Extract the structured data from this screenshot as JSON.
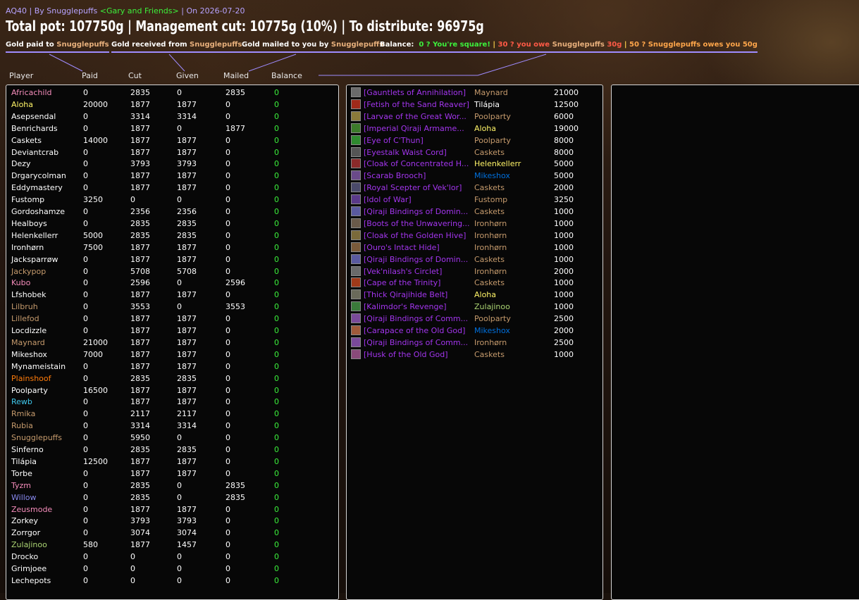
{
  "header": {
    "raid": "AQ40",
    "by_prefix": "By",
    "author": "Snugglepuffs",
    "guild": "<Gary and Friends>",
    "date_prefix": "On",
    "date": "2026-07-20",
    "headline": "Total pot: 107750g | Management cut: 10775g (10%) | To distribute: 96975g"
  },
  "legend": {
    "paid_label": "Gold paid to",
    "paid_name": "Snugglepuffs",
    "received_label": "Gold received from",
    "received_name": "Snugglepuffs",
    "mailed_label": "Gold mailed to you by",
    "mailed_name": "Snugglepuffs",
    "balance_label": "Balance:",
    "square_text": "0 ? You're square!",
    "sep1": "|",
    "owe_prefix": "30 ? you owe",
    "owe_name": "Snugglepuffs",
    "owe_amount": "30g",
    "sep2": "|",
    "owed_text": "50 ? Snugglepuffs owes you 50g",
    "colors": {
      "underline": "#9f8cff",
      "name": "#e8b07c",
      "square": "#3cf03c",
      "owe": "#ff5a46",
      "owed": "#ffa64a"
    }
  },
  "columns": [
    "Player",
    "Paid",
    "Cut",
    "Given",
    "Mailed",
    "Balance"
  ],
  "players": [
    {
      "name": "Africachild",
      "paid": "0",
      "cut": "2835",
      "given": "0",
      "mailed": "2835",
      "balance": "0",
      "color": "#f48cba"
    },
    {
      "name": "Aloha",
      "paid": "20000",
      "cut": "1877",
      "given": "1877",
      "mailed": "0",
      "balance": "0",
      "color": "#fff468"
    },
    {
      "name": "Asepsendal",
      "paid": "0",
      "cut": "3314",
      "given": "3314",
      "mailed": "0",
      "balance": "0",
      "color": "#ffffff"
    },
    {
      "name": "Benrichards",
      "paid": "0",
      "cut": "1877",
      "given": "0",
      "mailed": "1877",
      "balance": "0",
      "color": "#ffffff"
    },
    {
      "name": "Caskets",
      "paid": "14000",
      "cut": "1877",
      "given": "1877",
      "mailed": "0",
      "balance": "0",
      "color": "#ffffff"
    },
    {
      "name": "Deviantcrab",
      "paid": "0",
      "cut": "1877",
      "given": "1877",
      "mailed": "0",
      "balance": "0",
      "color": "#ffffff"
    },
    {
      "name": "Dezy",
      "paid": "0",
      "cut": "3793",
      "given": "3793",
      "mailed": "0",
      "balance": "0",
      "color": "#ffffff"
    },
    {
      "name": "Drgarycolman",
      "paid": "0",
      "cut": "1877",
      "given": "1877",
      "mailed": "0",
      "balance": "0",
      "color": "#ffffff"
    },
    {
      "name": "Eddymastery",
      "paid": "0",
      "cut": "1877",
      "given": "1877",
      "mailed": "0",
      "balance": "0",
      "color": "#ffffff"
    },
    {
      "name": "Fustomp",
      "paid": "3250",
      "cut": "0",
      "given": "0",
      "mailed": "0",
      "balance": "0",
      "color": "#ffffff"
    },
    {
      "name": "Gordoshamze",
      "paid": "0",
      "cut": "2356",
      "given": "2356",
      "mailed": "0",
      "balance": "0",
      "color": "#ffffff"
    },
    {
      "name": "Healboys",
      "paid": "0",
      "cut": "2835",
      "given": "2835",
      "mailed": "0",
      "balance": "0",
      "color": "#ffffff"
    },
    {
      "name": "Helenkellerr",
      "paid": "5000",
      "cut": "2835",
      "given": "2835",
      "mailed": "0",
      "balance": "0",
      "color": "#ffffff"
    },
    {
      "name": "Ironhørn",
      "paid": "7500",
      "cut": "1877",
      "given": "1877",
      "mailed": "0",
      "balance": "0",
      "color": "#ffffff"
    },
    {
      "name": "Jacksparrøw",
      "paid": "0",
      "cut": "1877",
      "given": "1877",
      "mailed": "0",
      "balance": "0",
      "color": "#ffffff"
    },
    {
      "name": "Jackypop",
      "paid": "0",
      "cut": "5708",
      "given": "5708",
      "mailed": "0",
      "balance": "0",
      "color": "#c69b6d"
    },
    {
      "name": "Kubo",
      "paid": "0",
      "cut": "2596",
      "given": "0",
      "mailed": "2596",
      "balance": "0",
      "color": "#f48cba"
    },
    {
      "name": "Lfshobek",
      "paid": "0",
      "cut": "1877",
      "given": "1877",
      "mailed": "0",
      "balance": "0",
      "color": "#ffffff"
    },
    {
      "name": "Lilbruh",
      "paid": "0",
      "cut": "3553",
      "given": "0",
      "mailed": "3553",
      "balance": "0",
      "color": "#c69b6d"
    },
    {
      "name": "Lillefod",
      "paid": "0",
      "cut": "1877",
      "given": "1877",
      "mailed": "0",
      "balance": "0",
      "color": "#c69b6d"
    },
    {
      "name": "Locdizzle",
      "paid": "0",
      "cut": "1877",
      "given": "1877",
      "mailed": "0",
      "balance": "0",
      "color": "#ffffff"
    },
    {
      "name": "Maynard",
      "paid": "21000",
      "cut": "1877",
      "given": "1877",
      "mailed": "0",
      "balance": "0",
      "color": "#c69b6d"
    },
    {
      "name": "Mikeshox",
      "paid": "7000",
      "cut": "1877",
      "given": "1877",
      "mailed": "0",
      "balance": "0",
      "color": "#ffffff"
    },
    {
      "name": "Mynameistain",
      "paid": "0",
      "cut": "1877",
      "given": "1877",
      "mailed": "0",
      "balance": "0",
      "color": "#ffffff"
    },
    {
      "name": "Plainshoof",
      "paid": "0",
      "cut": "2835",
      "given": "2835",
      "mailed": "0",
      "balance": "0",
      "color": "#ff7c0a"
    },
    {
      "name": "Poolparty",
      "paid": "16500",
      "cut": "1877",
      "given": "1877",
      "mailed": "0",
      "balance": "0",
      "color": "#ffffff"
    },
    {
      "name": "Rewb",
      "paid": "0",
      "cut": "1877",
      "given": "1877",
      "mailed": "0",
      "balance": "0",
      "color": "#3fc7eb"
    },
    {
      "name": "Rmika",
      "paid": "0",
      "cut": "2117",
      "given": "2117",
      "mailed": "0",
      "balance": "0",
      "color": "#c69b6d"
    },
    {
      "name": "Rubia",
      "paid": "0",
      "cut": "3314",
      "given": "3314",
      "mailed": "0",
      "balance": "0",
      "color": "#c69b6d"
    },
    {
      "name": "Snugglepuffs",
      "paid": "0",
      "cut": "5950",
      "given": "0",
      "mailed": "0",
      "balance": "0",
      "color": "#c69b6d"
    },
    {
      "name": "Sinferno",
      "paid": "0",
      "cut": "2835",
      "given": "2835",
      "mailed": "0",
      "balance": "0",
      "color": "#ffffff"
    },
    {
      "name": "Tilápia",
      "paid": "12500",
      "cut": "1877",
      "given": "1877",
      "mailed": "0",
      "balance": "0",
      "color": "#ffffff"
    },
    {
      "name": "Torbe",
      "paid": "0",
      "cut": "1877",
      "given": "1877",
      "mailed": "0",
      "balance": "0",
      "color": "#ffffff"
    },
    {
      "name": "Tyzm",
      "paid": "0",
      "cut": "2835",
      "given": "0",
      "mailed": "2835",
      "balance": "0",
      "color": "#f48cba"
    },
    {
      "name": "Willow",
      "paid": "0",
      "cut": "2835",
      "given": "0",
      "mailed": "2835",
      "balance": "0",
      "color": "#8788ee"
    },
    {
      "name": "Zeusmode",
      "paid": "0",
      "cut": "1877",
      "given": "1877",
      "mailed": "0",
      "balance": "0",
      "color": "#f48cba"
    },
    {
      "name": "Zorkey",
      "paid": "0",
      "cut": "3793",
      "given": "3793",
      "mailed": "0",
      "balance": "0",
      "color": "#ffffff"
    },
    {
      "name": "Zorrgor",
      "paid": "0",
      "cut": "3074",
      "given": "3074",
      "mailed": "0",
      "balance": "0",
      "color": "#ffffff"
    },
    {
      "name": "Zulajinoo",
      "paid": "580",
      "cut": "1877",
      "given": "1457",
      "mailed": "0",
      "balance": "0",
      "color": "#abd473"
    },
    {
      "name": "Drocko",
      "paid": "0",
      "cut": "0",
      "given": "0",
      "mailed": "0",
      "balance": "0",
      "color": "#ffffff"
    },
    {
      "name": "Grimjoee",
      "paid": "0",
      "cut": "0",
      "given": "0",
      "mailed": "0",
      "balance": "0",
      "color": "#ffffff"
    },
    {
      "name": "Lechepots",
      "paid": "0",
      "cut": "0",
      "given": "0",
      "mailed": "0",
      "balance": "0",
      "color": "#ffffff"
    }
  ],
  "balance_color": "#3cf03c",
  "items": [
    {
      "item": "[Gauntlets of Annihilation]",
      "winner": "Maynard",
      "price": "21000",
      "winner_color": "#c69b6d",
      "icon": "gauntlets-icon",
      "icon_color": "#6b6b6b"
    },
    {
      "item": "[Fetish of the Sand Reaver]",
      "winner": "Tilápia",
      "price": "12500",
      "winner_color": "#ffffff",
      "icon": "fetish-icon",
      "icon_color": "#a02a1a"
    },
    {
      "item": "[Larvae of the Great Wor...",
      "winner": "Poolparty",
      "price": "6000",
      "winner_color": "#c69b6d",
      "icon": "larvae-icon",
      "icon_color": "#8a7a3a"
    },
    {
      "item": "[Imperial Qiraji Armame...",
      "winner": "Aloha",
      "price": "19000",
      "winner_color": "#fff468",
      "icon": "armaments-icon",
      "icon_color": "#3c7a2a"
    },
    {
      "item": "[Eye of C'Thun]",
      "winner": "Poolparty",
      "price": "8000",
      "winner_color": "#c69b6d",
      "icon": "eye-icon",
      "icon_color": "#2f8a2f"
    },
    {
      "item": "[Eyestalk Waist Cord]",
      "winner": "Caskets",
      "price": "8000",
      "winner_color": "#c69b6d",
      "icon": "belt-icon",
      "icon_color": "#555555"
    },
    {
      "item": "[Cloak of Concentrated H...",
      "winner": "Helenkellerr",
      "price": "5000",
      "winner_color": "#fff468",
      "icon": "cloak-icon",
      "icon_color": "#8a2a2a"
    },
    {
      "item": "[Scarab Brooch]",
      "winner": "Mikeshox",
      "price": "5000",
      "winner_color": "#0070dd",
      "icon": "brooch-icon",
      "icon_color": "#6a4a8a"
    },
    {
      "item": "[Royal Scepter of Vek'lor]",
      "winner": "Caskets",
      "price": "2000",
      "winner_color": "#c69b6d",
      "icon": "scepter-icon",
      "icon_color": "#4a4a6a"
    },
    {
      "item": "[Idol of War]",
      "winner": "Fustomp",
      "price": "3250",
      "winner_color": "#c69b6d",
      "icon": "idol-icon",
      "icon_color": "#5a3a8a"
    },
    {
      "item": "[Qiraji Bindings of Domin...",
      "winner": "Caskets",
      "price": "1000",
      "winner_color": "#c69b6d",
      "icon": "bindings-icon",
      "icon_color": "#5a5aa0"
    },
    {
      "item": "[Boots of the Unwavering...",
      "winner": "Ironhørn",
      "price": "1000",
      "winner_color": "#c69b6d",
      "icon": "boots-icon",
      "icon_color": "#6a5a4a"
    },
    {
      "item": "[Cloak of the Golden Hive]",
      "winner": "Ironhørn",
      "price": "1000",
      "winner_color": "#c69b6d",
      "icon": "cloak-icon",
      "icon_color": "#7a6a3a"
    },
    {
      "item": "[Ouro's Intact Hide]",
      "winner": "Ironhørn",
      "price": "1000",
      "winner_color": "#c69b6d",
      "icon": "hide-icon",
      "icon_color": "#7a5a3a"
    },
    {
      "item": "[Qiraji Bindings of Domin...",
      "winner": "Caskets",
      "price": "1000",
      "winner_color": "#c69b6d",
      "icon": "bindings-icon",
      "icon_color": "#5a5aa0"
    },
    {
      "item": "[Vek'nilash's Circlet]",
      "winner": "Ironhørn",
      "price": "2000",
      "winner_color": "#c69b6d",
      "icon": "circlet-icon",
      "icon_color": "#6a6a6a"
    },
    {
      "item": "[Cape of the Trinity]",
      "winner": "Caskets",
      "price": "1000",
      "winner_color": "#c69b6d",
      "icon": "cape-icon",
      "icon_color": "#a03a1a"
    },
    {
      "item": "[Thick Qirajihide Belt]",
      "winner": "Aloha",
      "price": "1000",
      "winner_color": "#fff468",
      "icon": "belt-icon",
      "icon_color": "#6a6a5a"
    },
    {
      "item": "[Kalimdor's Revenge]",
      "winner": "Zulajinoo",
      "price": "1000",
      "winner_color": "#abd473",
      "icon": "sword-icon",
      "icon_color": "#3a7a3a"
    },
    {
      "item": "[Qiraji Bindings of Comm...",
      "winner": "Poolparty",
      "price": "2500",
      "winner_color": "#c69b6d",
      "icon": "bindings-icon",
      "icon_color": "#7a4a9a"
    },
    {
      "item": "[Carapace of the Old God]",
      "winner": "Mikeshox",
      "price": "2000",
      "winner_color": "#0070dd",
      "icon": "carapace-icon",
      "icon_color": "#a05a3a"
    },
    {
      "item": "[Qiraji Bindings of Comm...",
      "winner": "Ironhørn",
      "price": "2500",
      "winner_color": "#c69b6d",
      "icon": "bindings-icon",
      "icon_color": "#7a4a9a"
    },
    {
      "item": "[Husk of the Old God]",
      "winner": "Caskets",
      "price": "1000",
      "winner_color": "#c69b6d",
      "icon": "husk-icon",
      "icon_color": "#8a4a7a"
    }
  ]
}
